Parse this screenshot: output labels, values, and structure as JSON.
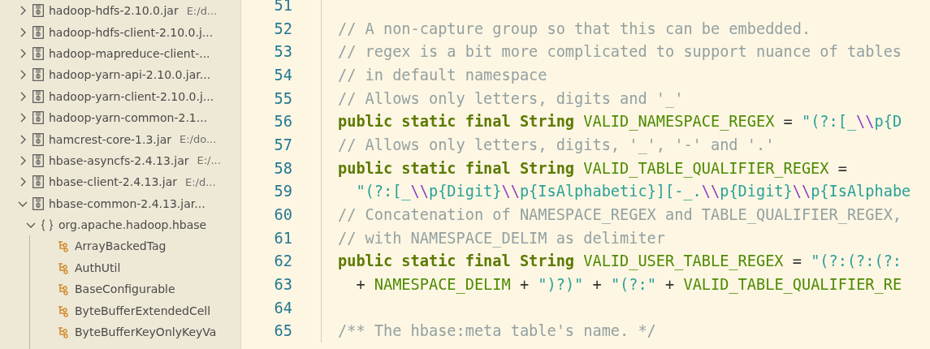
{
  "sidebar": {
    "items": [
      {
        "kind": "jar",
        "label": "hadoop-hdfs-2.10.0.jar",
        "detail": "E:/d...",
        "expanded": false
      },
      {
        "kind": "jar",
        "label": "hadoop-hdfs-client-2.10.0.j...",
        "expanded": false
      },
      {
        "kind": "jar",
        "label": "hadoop-mapreduce-client-...",
        "expanded": false
      },
      {
        "kind": "jar",
        "label": "hadoop-yarn-api-2.10.0.jar...",
        "expanded": false
      },
      {
        "kind": "jar",
        "label": "hadoop-yarn-client-2.10.0.j...",
        "expanded": false
      },
      {
        "kind": "jar",
        "label": "hadoop-yarn-common-2.1...",
        "expanded": false
      },
      {
        "kind": "jar",
        "label": "hamcrest-core-1.3.jar",
        "detail": "E:/do...",
        "expanded": false
      },
      {
        "kind": "jar",
        "label": "hbase-asyncfs-2.4.13.jar",
        "detail": "E:/...",
        "expanded": false
      },
      {
        "kind": "jar",
        "label": "hbase-client-2.4.13.jar",
        "detail": "E:/d...",
        "expanded": false
      },
      {
        "kind": "jar",
        "label": "hbase-common-2.4.13.jar...",
        "expanded": true,
        "children": [
          {
            "kind": "package",
            "label": "org.apache.hadoop.hbase",
            "expanded": true,
            "children": [
              {
                "kind": "class",
                "label": "ArrayBackedTag"
              },
              {
                "kind": "class",
                "label": "AuthUtil"
              },
              {
                "kind": "class",
                "label": "BaseConfigurable"
              },
              {
                "kind": "class",
                "label": "ByteBufferExtendedCell"
              },
              {
                "kind": "class",
                "label": "ByteBufferKeyOnlyKeyVa"
              }
            ]
          }
        ]
      }
    ]
  },
  "editor": {
    "lines": [
      {
        "number": "51"
      },
      {
        "number": "52",
        "tokens": [
          {
            "kind": "comment",
            "text": "// A non-capture group so that this can be embedded."
          }
        ]
      },
      {
        "number": "53",
        "tokens": [
          {
            "kind": "comment",
            "text": "// regex is a bit more complicated to support nuance of tables"
          }
        ]
      },
      {
        "number": "54",
        "tokens": [
          {
            "kind": "comment",
            "text": "// in default namespace"
          }
        ]
      },
      {
        "number": "55",
        "tokens": [
          {
            "kind": "comment",
            "text": "// Allows only letters, digits and '_'"
          }
        ]
      },
      {
        "number": "56",
        "tokens": [
          {
            "kind": "keyword",
            "text": "public static final String "
          },
          {
            "kind": "ident",
            "text": "VALID_NAMESPACE_REGEX"
          },
          {
            "kind": "plain",
            "text": " = "
          },
          {
            "kind": "string",
            "text": "\"(?:[_"
          },
          {
            "kind": "escape",
            "text": "\\\\"
          },
          {
            "kind": "string",
            "text": "p{D"
          }
        ]
      },
      {
        "number": "57",
        "tokens": [
          {
            "kind": "comment",
            "text": "// Allows only letters, digits, '_', '-' and '.'"
          }
        ]
      },
      {
        "number": "58",
        "tokens": [
          {
            "kind": "keyword",
            "text": "public static final String "
          },
          {
            "kind": "ident",
            "text": "VALID_TABLE_QUALIFIER_REGEX"
          },
          {
            "kind": "plain",
            "text": " ="
          }
        ]
      },
      {
        "number": "59",
        "tokens": [
          {
            "kind": "string",
            "text": "  \"(?:[_"
          },
          {
            "kind": "escape",
            "text": "\\\\"
          },
          {
            "kind": "string",
            "text": "p{Digit}"
          },
          {
            "kind": "escape",
            "text": "\\\\"
          },
          {
            "kind": "string",
            "text": "p{IsAlphabetic}][-_."
          },
          {
            "kind": "escape",
            "text": "\\\\"
          },
          {
            "kind": "string",
            "text": "p{Digit}"
          },
          {
            "kind": "escape",
            "text": "\\\\"
          },
          {
            "kind": "string",
            "text": "p{IsAlphabe"
          }
        ]
      },
      {
        "number": "60",
        "tokens": [
          {
            "kind": "comment",
            "text": "// Concatenation of NAMESPACE_REGEX and TABLE_QUALIFIER_REGEX,"
          }
        ]
      },
      {
        "number": "61",
        "tokens": [
          {
            "kind": "comment",
            "text": "// with NAMESPACE_DELIM as delimiter"
          }
        ]
      },
      {
        "number": "62",
        "tokens": [
          {
            "kind": "keyword",
            "text": "public static final String "
          },
          {
            "kind": "ident",
            "text": "VALID_USER_TABLE_REGEX"
          },
          {
            "kind": "plain",
            "text": " = "
          },
          {
            "kind": "string",
            "text": "\"(?:(?:(?:"
          }
        ]
      },
      {
        "number": "63",
        "tokens": [
          {
            "kind": "plain",
            "text": "  + "
          },
          {
            "kind": "ident",
            "text": "NAMESPACE_DELIM"
          },
          {
            "kind": "plain",
            "text": " + "
          },
          {
            "kind": "string",
            "text": "\")?)\""
          },
          {
            "kind": "plain",
            "text": " + "
          },
          {
            "kind": "string",
            "text": "\"(?:\""
          },
          {
            "kind": "plain",
            "text": " + "
          },
          {
            "kind": "ident",
            "text": "VALID_TABLE_QUALIFIER_RE"
          }
        ]
      },
      {
        "number": "64"
      },
      {
        "number": "65",
        "tokens": [
          {
            "kind": "comment",
            "text": "/** The hbase:meta table's name. */"
          }
        ]
      }
    ]
  }
}
